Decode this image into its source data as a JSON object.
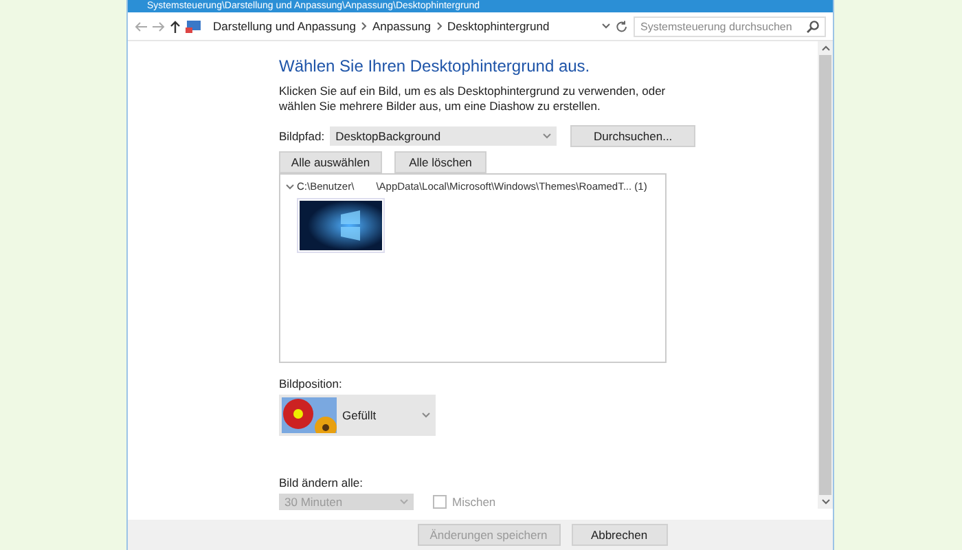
{
  "window": {
    "title": "Systemsteuerung\\Darstellung und Anpassung\\Anpassung\\Desktophintergrund"
  },
  "address_bar": {
    "breadcrumbs": [
      "Darstellung und Anpassung",
      "Anpassung",
      "Desktophintergrund"
    ],
    "search": {
      "placeholder": "Systemsteuerung durchsuchen"
    }
  },
  "heading": "Wählen Sie Ihren Desktophintergrund aus.",
  "description": "Klicken Sie auf ein Bild, um es als Desktophintergrund zu verwenden, oder wählen Sie mehrere Bilder aus, um eine Diashow zu erstellen.",
  "image_path": {
    "label": "Bildpfad:",
    "value": "DesktopBackground"
  },
  "browse_button": "Durchsuchen...",
  "select_all_button": "Alle auswählen",
  "clear_all_button": "Alle löschen",
  "image_group": {
    "path_start": "C:\\Benutzer\\",
    "path_end": "\\AppData\\Local\\Microsoft\\Windows\\Themes\\RoamedT... (1)",
    "expanded": true
  },
  "position": {
    "label": "Bildposition:",
    "value": "Gefüllt"
  },
  "interval": {
    "label": "Bild ändern alle:",
    "value": "30 Minuten",
    "disabled": true
  },
  "shuffle": {
    "label": "Mischen",
    "checked": false,
    "disabled": true
  },
  "footer_buttons": [
    {
      "label": "Änderungen speichern",
      "disabled": true
    },
    {
      "label": "Abbrechen",
      "disabled": false
    }
  ]
}
